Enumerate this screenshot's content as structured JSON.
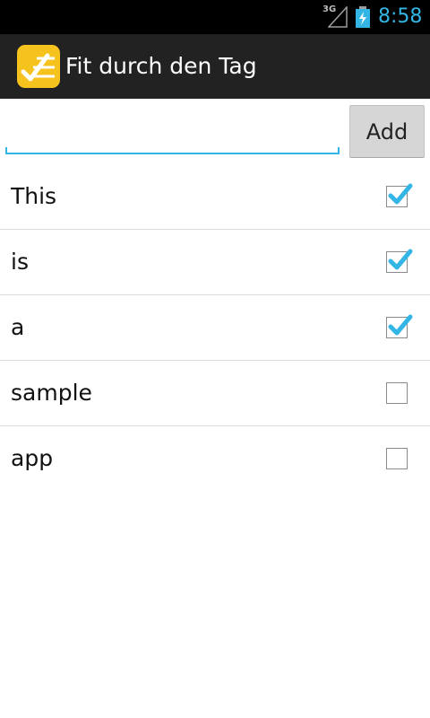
{
  "status_bar": {
    "network": "3G",
    "time": "8:58",
    "icons": [
      "signal-icon",
      "battery-charging-icon"
    ]
  },
  "app": {
    "title": "Fit durch den Tag",
    "logo_icon": "app-logo-icon",
    "logo_color": "#f6c21d"
  },
  "input": {
    "value": "",
    "placeholder": ""
  },
  "add_button": {
    "label": "Add"
  },
  "tasks": [
    {
      "label": "This",
      "checked": true
    },
    {
      "label": "is",
      "checked": true
    },
    {
      "label": "a",
      "checked": true
    },
    {
      "label": "sample",
      "checked": false
    },
    {
      "label": "app",
      "checked": false
    }
  ],
  "colors": {
    "accent": "#33b5e5",
    "action_bar": "#222222",
    "status_bar": "#000000"
  }
}
